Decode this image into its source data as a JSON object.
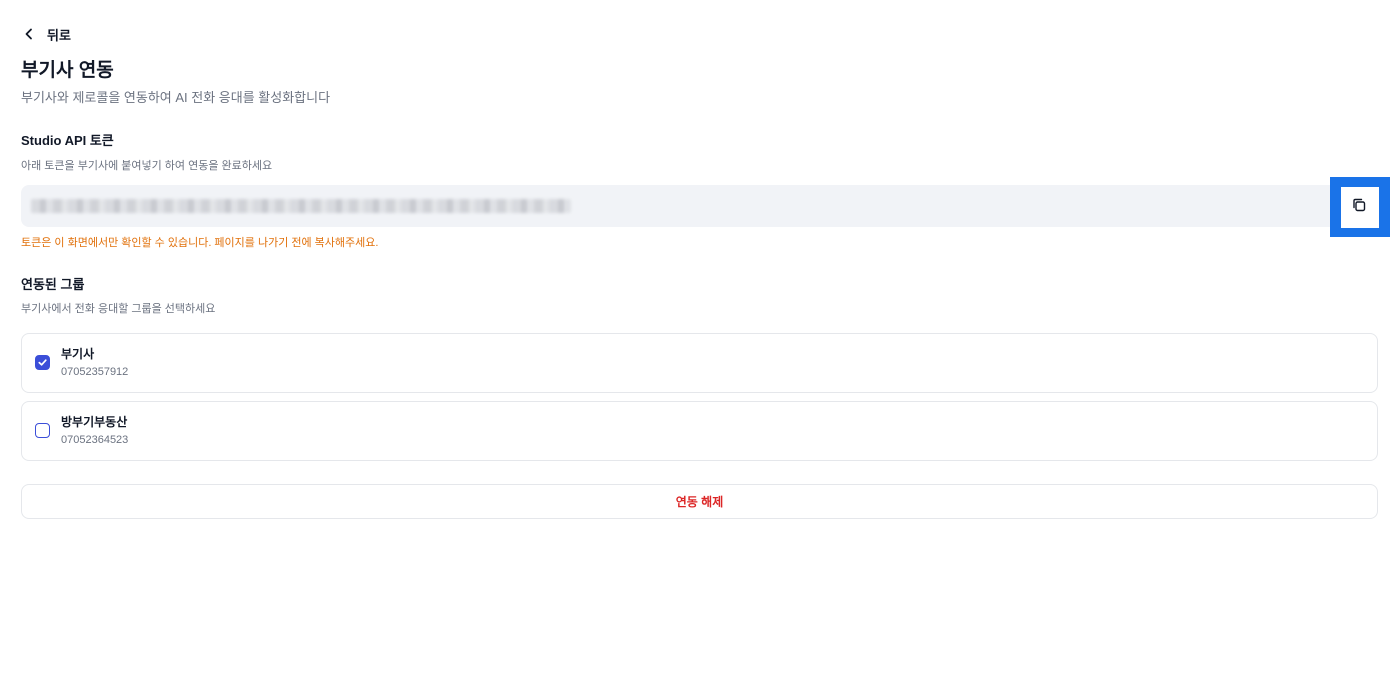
{
  "nav": {
    "back_label": "뒤로"
  },
  "header": {
    "title": "부기사 연동",
    "subtitle": "부기사와 제로콜을 연동하여 AI 전화 응대를 활성화합니다"
  },
  "token_section": {
    "title": "Studio API 토큰",
    "description": "아래 토큰을 부기사에 붙여넣기 하여 연동을 완료하세요",
    "token_masked": true,
    "copy_icon": "copy-icon",
    "warning": "토큰은 이 화면에서만 확인할 수 있습니다. 페이지를 나가기 전에 복사해주세요."
  },
  "groups_section": {
    "title": "연동된 그룹",
    "description": "부기사에서 전화 응대할 그룹을 선택하세요",
    "groups": [
      {
        "name": "부기사",
        "phone": "07052357912",
        "checked": true
      },
      {
        "name": "방부기부동산",
        "phone": "07052364523",
        "checked": false
      }
    ]
  },
  "actions": {
    "unlink_label": "연동 해제"
  },
  "colors": {
    "accent": "#3b4ed8",
    "warning": "#e1700a",
    "danger": "#dc2626",
    "token_bg": "#f1f3f7",
    "focus_marker": "#1a73e8"
  }
}
